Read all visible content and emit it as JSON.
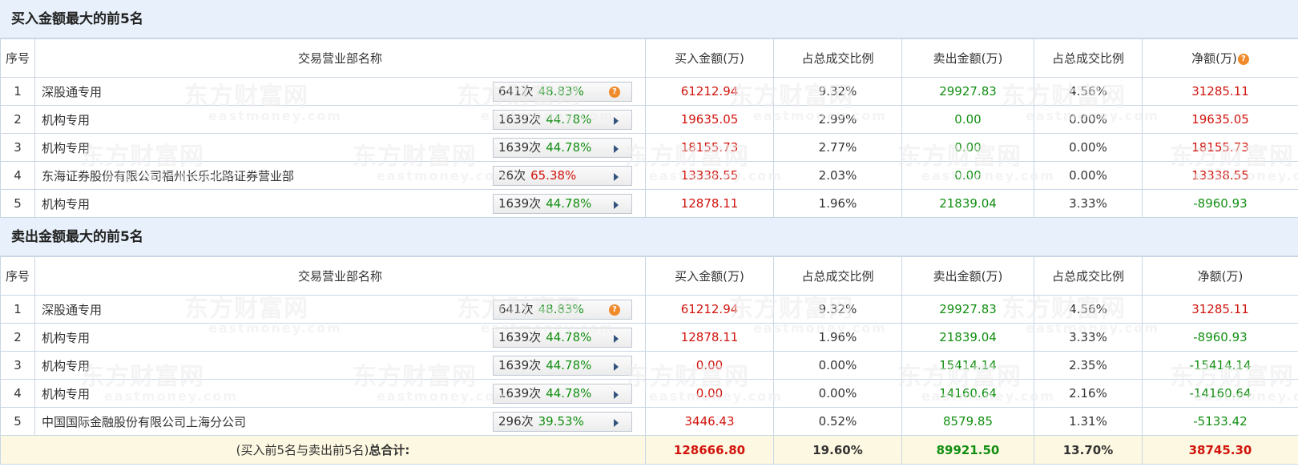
{
  "buy_section": {
    "title": "买入金额最大的前5名",
    "headers": [
      "序号",
      "交易营业部名称",
      "买入金额(万)",
      "占总成交比例",
      "卖出金额(万)",
      "占总成交比例",
      "净额(万)"
    ],
    "rows": [
      {
        "idx": "1",
        "name": "深股通专用",
        "count": "641次",
        "rate": "48.83%",
        "rate_color": "green",
        "icon": "help",
        "buy": "61212.94",
        "buy_pct": "9.32%",
        "sell": "29927.83",
        "sell_pct": "4.56%",
        "net": "31285.11",
        "net_color": "red"
      },
      {
        "idx": "2",
        "name": "机构专用",
        "count": "1639次",
        "rate": "44.78%",
        "rate_color": "green",
        "icon": "arrow",
        "buy": "19635.05",
        "buy_pct": "2.99%",
        "sell": "0.00",
        "sell_pct": "0.00%",
        "net": "19635.05",
        "net_color": "red"
      },
      {
        "idx": "3",
        "name": "机构专用",
        "count": "1639次",
        "rate": "44.78%",
        "rate_color": "green",
        "icon": "arrow",
        "buy": "18155.73",
        "buy_pct": "2.77%",
        "sell": "0.00",
        "sell_pct": "0.00%",
        "net": "18155.73",
        "net_color": "red"
      },
      {
        "idx": "4",
        "name": "东海证券股份有限公司福州长乐北路证券营业部",
        "count": "26次",
        "rate": "65.38%",
        "rate_color": "red",
        "icon": "arrow",
        "buy": "13338.55",
        "buy_pct": "2.03%",
        "sell": "0.00",
        "sell_pct": "0.00%",
        "net": "13338.55",
        "net_color": "red"
      },
      {
        "idx": "5",
        "name": "机构专用",
        "count": "1639次",
        "rate": "44.78%",
        "rate_color": "green",
        "icon": "arrow",
        "buy": "12878.11",
        "buy_pct": "1.96%",
        "sell": "21839.04",
        "sell_pct": "3.33%",
        "net": "-8960.93",
        "net_color": "green"
      }
    ]
  },
  "sell_section": {
    "title": "卖出金额最大的前5名",
    "headers": [
      "序号",
      "交易营业部名称",
      "买入金额(万)",
      "占总成交比例",
      "卖出金额(万)",
      "占总成交比例",
      "净额(万)"
    ],
    "rows": [
      {
        "idx": "1",
        "name": "深股通专用",
        "count": "641次",
        "rate": "48.83%",
        "rate_color": "green",
        "icon": "help",
        "buy": "61212.94",
        "buy_pct": "9.32%",
        "sell": "29927.83",
        "sell_pct": "4.56%",
        "net": "31285.11",
        "net_color": "red"
      },
      {
        "idx": "2",
        "name": "机构专用",
        "count": "1639次",
        "rate": "44.78%",
        "rate_color": "green",
        "icon": "arrow",
        "buy": "12878.11",
        "buy_pct": "1.96%",
        "sell": "21839.04",
        "sell_pct": "3.33%",
        "net": "-8960.93",
        "net_color": "green"
      },
      {
        "idx": "3",
        "name": "机构专用",
        "count": "1639次",
        "rate": "44.78%",
        "rate_color": "green",
        "icon": "arrow",
        "buy": "0.00",
        "buy_pct": "0.00%",
        "sell": "15414.14",
        "sell_pct": "2.35%",
        "net": "-15414.14",
        "net_color": "green"
      },
      {
        "idx": "4",
        "name": "机构专用",
        "count": "1639次",
        "rate": "44.78%",
        "rate_color": "green",
        "icon": "arrow",
        "buy": "0.00",
        "buy_pct": "0.00%",
        "sell": "14160.64",
        "sell_pct": "2.16%",
        "net": "-14160.64",
        "net_color": "green"
      },
      {
        "idx": "5",
        "name": "中国国际金融股份有限公司上海分公司",
        "count": "296次",
        "rate": "39.53%",
        "rate_color": "green",
        "icon": "arrow",
        "buy": "3446.43",
        "buy_pct": "0.52%",
        "sell": "8579.85",
        "sell_pct": "1.31%",
        "net": "-5133.42",
        "net_color": "green"
      }
    ]
  },
  "total": {
    "label_prefix": "(买入前5名与卖出前5名)",
    "label_bold": "总合计:",
    "buy": "128666.80",
    "buy_pct": "19.60%",
    "sell": "89921.50",
    "sell_pct": "13.70%",
    "net": "38745.30"
  },
  "watermark": {
    "cn": "东方财富网",
    "en": "eastmoney.com"
  },
  "icons": {
    "help": "question-circle-icon",
    "arrow": "triangle-right-icon"
  },
  "colors": {
    "red": "#d1140d",
    "green": "#128f12",
    "header_bg": "#e8f1fb",
    "total_bg": "#fdf8e1"
  }
}
